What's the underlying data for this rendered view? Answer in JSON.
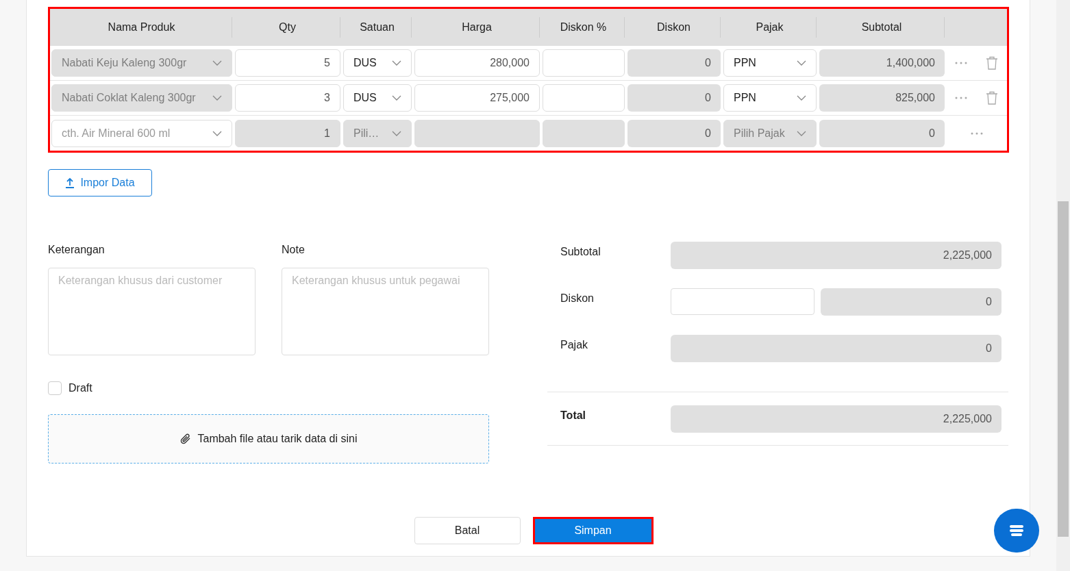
{
  "table": {
    "highlighted": true,
    "columns": [
      "Nama Produk",
      "Qty",
      "Satuan",
      "Harga",
      "Diskon %",
      "Diskon",
      "Pajak",
      "Subtotal"
    ],
    "rows": [
      {
        "product": {
          "value": "Nabati Keju Kaleng 300gr",
          "disabled": true
        },
        "qty": {
          "value": "5",
          "disabled": false
        },
        "unit": {
          "value": "DUS",
          "disabled": false
        },
        "price": {
          "value": "280,000",
          "disabled": false
        },
        "discount_pct": {
          "disabled": false
        },
        "discount": {
          "value": "0"
        },
        "tax": {
          "value": "PPN",
          "disabled": false
        },
        "subtotal": {
          "value": "1,400,000"
        },
        "deletable": true
      },
      {
        "product": {
          "value": "Nabati Coklat Kaleng 300gr",
          "disabled": true
        },
        "qty": {
          "value": "3",
          "disabled": false
        },
        "unit": {
          "value": "DUS",
          "disabled": false
        },
        "price": {
          "value": "275,000",
          "disabled": false
        },
        "discount_pct": {
          "disabled": false
        },
        "discount": {
          "value": "0"
        },
        "tax": {
          "value": "PPN",
          "disabled": false
        },
        "subtotal": {
          "value": "825,000"
        },
        "deletable": true
      },
      {
        "product": {
          "placeholder": "cth. Air Mineral 600 ml",
          "disabled": false
        },
        "qty": {
          "value": "1",
          "disabled": true
        },
        "unit": {
          "placeholder": "Pili…",
          "disabled": true
        },
        "price": {
          "disabled": true
        },
        "discount_pct": {
          "disabled": true
        },
        "discount": {
          "value": "0"
        },
        "tax": {
          "placeholder": "Pilih Pajak",
          "disabled": true
        },
        "subtotal": {
          "value": "0"
        },
        "deletable": false
      }
    ]
  },
  "import_button": "Impor Data",
  "remarks": {
    "label": "Keterangan",
    "placeholder": "Keterangan khusus dari customer"
  },
  "note": {
    "label": "Note",
    "placeholder": "Keterangan khusus untuk pegawai"
  },
  "draft": {
    "label": "Draft",
    "checked": false
  },
  "dropzone": "Tambah file atau tarik data di sini",
  "summary": {
    "subtotal": {
      "label": "Subtotal",
      "value": "2,225,000"
    },
    "discount": {
      "label": "Diskon",
      "value": "0"
    },
    "tax": {
      "label": "Pajak",
      "value": "0"
    },
    "total": {
      "label": "Total",
      "value": "2,225,000"
    }
  },
  "buttons": {
    "cancel": "Batal",
    "save": {
      "label": "Simpan",
      "highlighted": true
    }
  }
}
